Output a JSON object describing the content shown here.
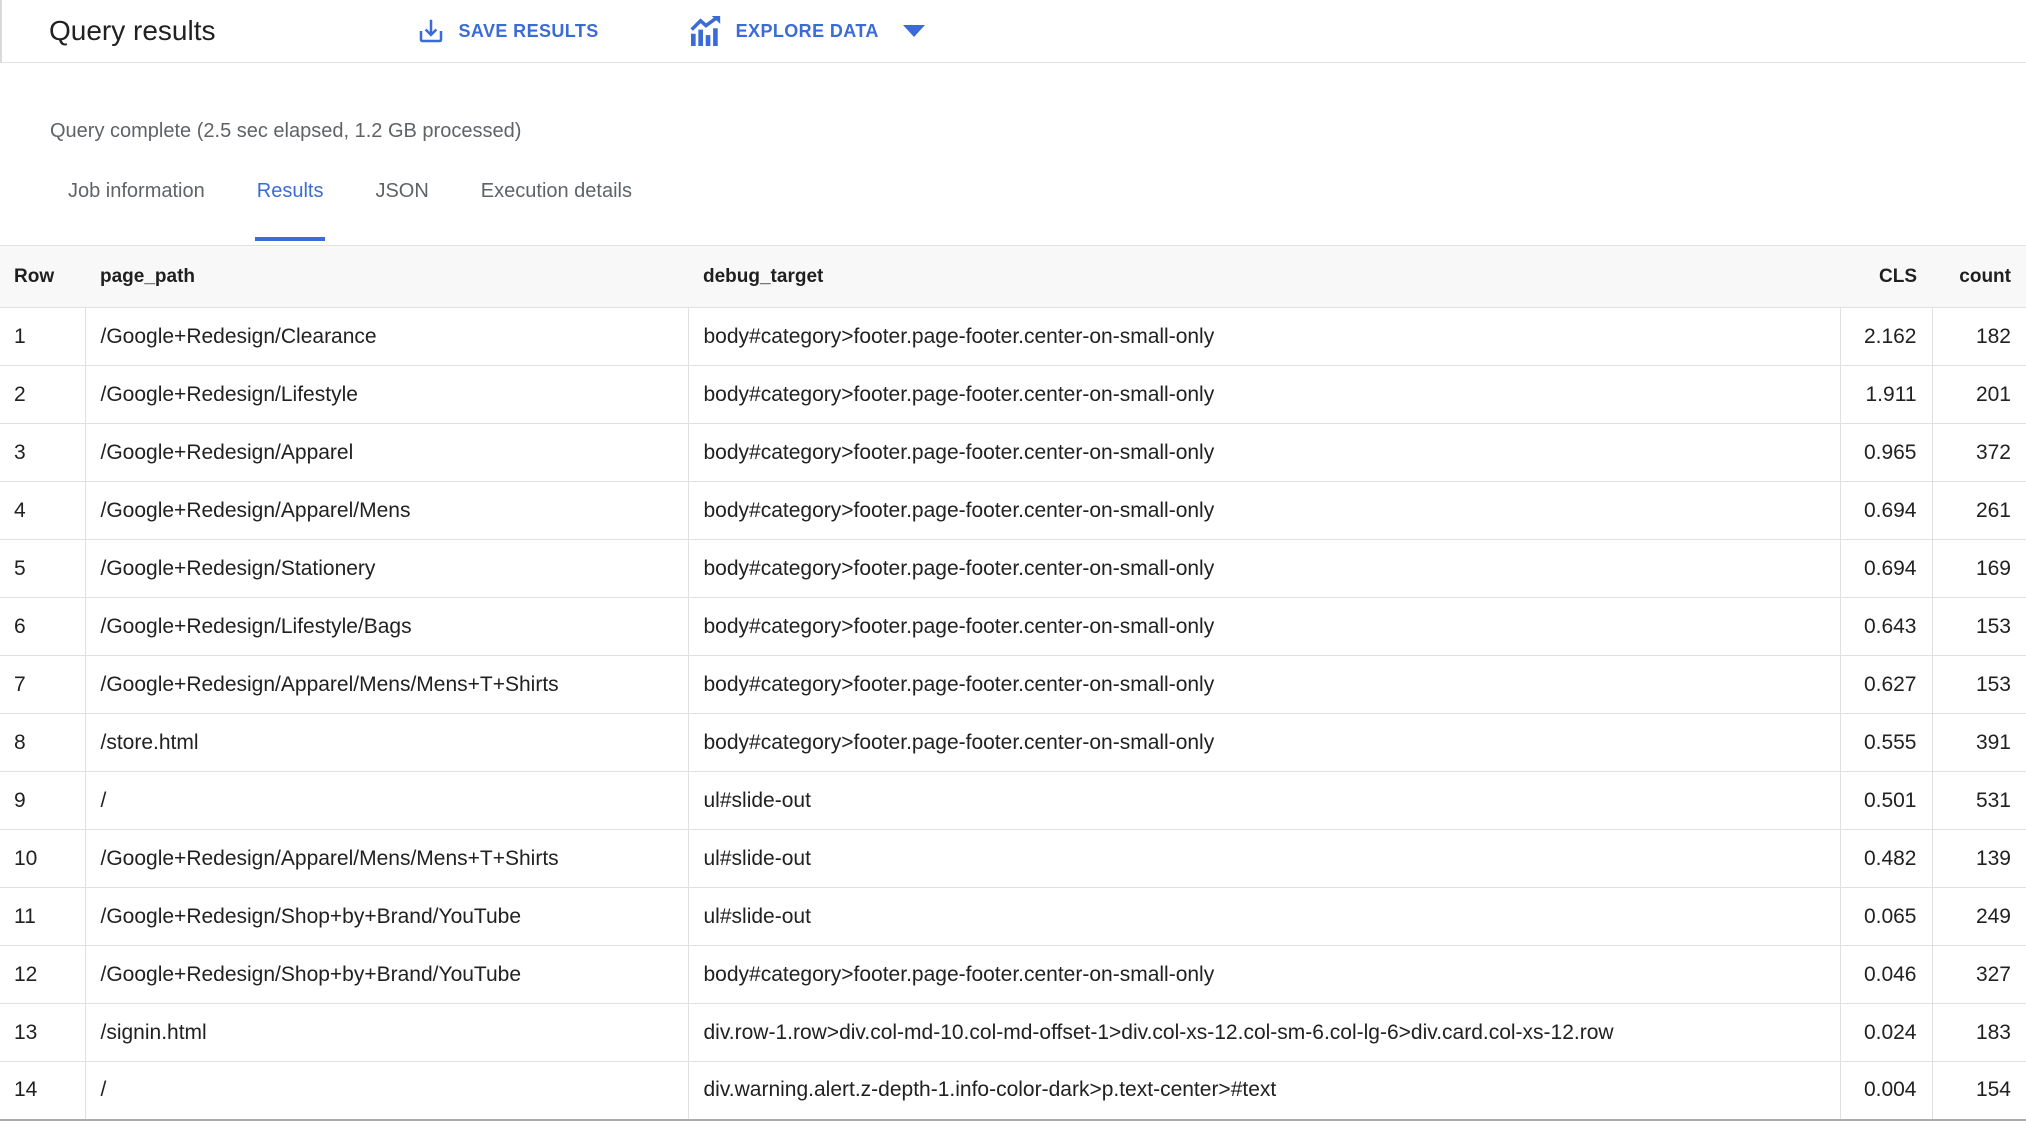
{
  "header": {
    "title": "Query results",
    "save_label": "SAVE RESULTS",
    "explore_label": "EXPLORE DATA"
  },
  "status_text": "Query complete (2.5 sec elapsed, 1.2 GB processed)",
  "tabs": [
    {
      "label": "Job information",
      "active": false
    },
    {
      "label": "Results",
      "active": true
    },
    {
      "label": "JSON",
      "active": false
    },
    {
      "label": "Execution details",
      "active": false
    }
  ],
  "colors": {
    "accent_blue": "#3b6cd6",
    "muted_text": "#5f6368",
    "table_border": "#e0e0e0",
    "header_row_bg": "#f8f8f8"
  },
  "icons": {
    "save": "download-icon",
    "explore": "chart-insights-icon",
    "explore_caret": "dropdown-caret-icon"
  },
  "table": {
    "columns": [
      "Row",
      "page_path",
      "debug_target",
      "CLS",
      "count"
    ],
    "rows": [
      [
        "1",
        "/Google+Redesign/Clearance",
        "body#category>footer.page-footer.center-on-small-only",
        "2.162",
        "182"
      ],
      [
        "2",
        "/Google+Redesign/Lifestyle",
        "body#category>footer.page-footer.center-on-small-only",
        "1.911",
        "201"
      ],
      [
        "3",
        "/Google+Redesign/Apparel",
        "body#category>footer.page-footer.center-on-small-only",
        "0.965",
        "372"
      ],
      [
        "4",
        "/Google+Redesign/Apparel/Mens",
        "body#category>footer.page-footer.center-on-small-only",
        "0.694",
        "261"
      ],
      [
        "5",
        "/Google+Redesign/Stationery",
        "body#category>footer.page-footer.center-on-small-only",
        "0.694",
        "169"
      ],
      [
        "6",
        "/Google+Redesign/Lifestyle/Bags",
        "body#category>footer.page-footer.center-on-small-only",
        "0.643",
        "153"
      ],
      [
        "7",
        "/Google+Redesign/Apparel/Mens/Mens+T+Shirts",
        "body#category>footer.page-footer.center-on-small-only",
        "0.627",
        "153"
      ],
      [
        "8",
        "/store.html",
        "body#category>footer.page-footer.center-on-small-only",
        "0.555",
        "391"
      ],
      [
        "9",
        "/",
        "ul#slide-out",
        "0.501",
        "531"
      ],
      [
        "10",
        "/Google+Redesign/Apparel/Mens/Mens+T+Shirts",
        "ul#slide-out",
        "0.482",
        "139"
      ],
      [
        "11",
        "/Google+Redesign/Shop+by+Brand/YouTube",
        "ul#slide-out",
        "0.065",
        "249"
      ],
      [
        "12",
        "/Google+Redesign/Shop+by+Brand/YouTube",
        "body#category>footer.page-footer.center-on-small-only",
        "0.046",
        "327"
      ],
      [
        "13",
        "/signin.html",
        "div.row-1.row>div.col-md-10.col-md-offset-1>div.col-xs-12.col-sm-6.col-lg-6>div.card.col-xs-12.row",
        "0.024",
        "183"
      ],
      [
        "14",
        "/",
        "div.warning.alert.z-depth-1.info-color-dark>p.text-center>#text",
        "0.004",
        "154"
      ]
    ]
  }
}
